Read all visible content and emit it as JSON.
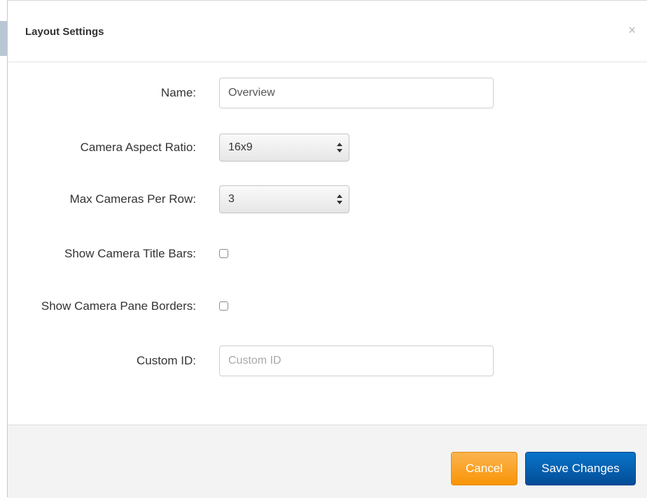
{
  "modal": {
    "title": "Layout Settings",
    "close_glyph": "×"
  },
  "form": {
    "name": {
      "label": "Name:",
      "value": "Overview"
    },
    "aspect_ratio": {
      "label": "Camera Aspect Ratio:",
      "value": "16x9"
    },
    "max_per_row": {
      "label": "Max Cameras Per Row:",
      "value": "3"
    },
    "show_title_bars": {
      "label": "Show Camera Title Bars:",
      "checked": false
    },
    "show_pane_borders": {
      "label": "Show Camera Pane Borders:",
      "checked": false
    },
    "custom_id": {
      "label": "Custom ID:",
      "value": "",
      "placeholder": "Custom ID"
    }
  },
  "footer": {
    "cancel_label": "Cancel",
    "save_label": "Save Changes"
  },
  "colors": {
    "cancel": "#f89406",
    "save": "#034d97"
  }
}
